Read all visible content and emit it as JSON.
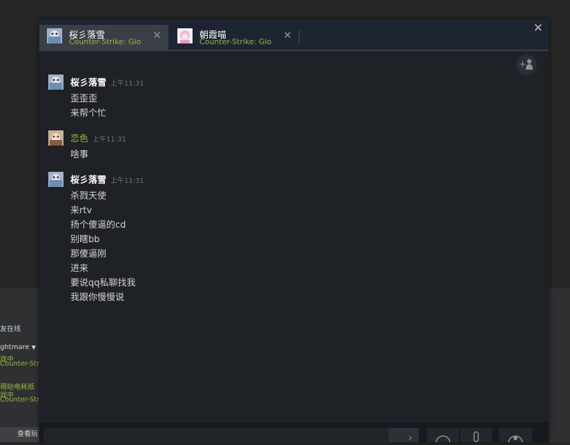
{
  "background_window": {
    "online_label": "友在线",
    "friend1_name": "ghtmare",
    "friend1_status": "戏中",
    "friend1_game": "Counter-Strike",
    "friend2_name": "萌哒电耗纸",
    "friend2_status": "戏中",
    "friend2_game": "Counter-Strike",
    "view_games_button": "查看玩"
  },
  "tabs": [
    {
      "name": "桜彡落雪",
      "game": "Counter-Strike: Glo",
      "close": "✕"
    },
    {
      "name": "朝霞喵",
      "game": "Counter-Strike: Glo",
      "close": "✕"
    }
  ],
  "window_close": "✕",
  "messages": [
    {
      "sender": "桜彡落雪",
      "time": "上午11:31",
      "lines": [
        "歪歪歪",
        "来帮个忙"
      ]
    },
    {
      "sender": "恋色",
      "time": "上午11:31",
      "lines": [
        "啥事"
      ]
    },
    {
      "sender": "桜彡落雪",
      "time": "上午11:31",
      "lines": [
        "杀戮天使",
        "来rtv",
        "扬个傻逼的cd",
        "别瞎bb",
        "那傻逼刚",
        "进来",
        "要说qq私聊找我",
        "我跟你慢慢说"
      ]
    }
  ],
  "icons": {
    "add_user": "add-user-icon",
    "send": "send-icon",
    "emoticon": "emoticon-icon",
    "mic": "microphone-icon",
    "voice": "voice-chat-icon"
  },
  "colors": {
    "game_green": "#90ba3c",
    "window_bg": "#1e2126",
    "active_tab": "#3a3f47"
  }
}
